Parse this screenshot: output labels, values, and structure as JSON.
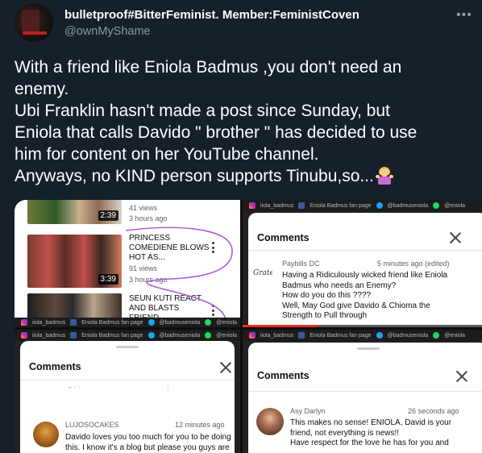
{
  "author": {
    "display_name": "bulletproof#BitterFeminist. Member:FeministCoven",
    "handle": "@ownMyShame",
    "avatar": "dark-red-profile-avatar"
  },
  "more_icon": "more-horizontal-icon",
  "tweet_lines": [
    "With a friend like Eniola Badmus ,you don't need an",
    "enemy.",
    "Ubi Franklin hasn't made a post since Sunday, but",
    "Eniola that calls Davido \" brother \"  has decided to use",
    "him for content on her YouTube channel.",
    "Anyways,  no KIND person supports Tinubu,so..."
  ],
  "tweet_emoji": "woman-shrugging-icon",
  "colors": {
    "background": "#15202b",
    "secondary_text": "#8b98a5",
    "youtube_red": "#e52d27",
    "annotation_purple": "#b05ad8"
  },
  "youtube_list": {
    "videos": [
      {
        "duration": "2:39",
        "title": "",
        "views": "41 views",
        "age": "3 hours ago"
      },
      {
        "duration": "3:39",
        "title": "PRINCESS COMEDIENE BLOWS HOT AS...",
        "views": "91 views",
        "age": "3 hours ago"
      },
      {
        "duration": "",
        "title": "SEUN KUTI REACT AND BLASTS FRIEND...",
        "views": "",
        "age": ""
      }
    ],
    "watermark": [
      "iiola_badmus",
      "Eniola Badmus fan page",
      "@badmuseniola",
      "@eniola"
    ]
  },
  "comment_sheets": [
    {
      "heading": "Comments",
      "watermark": [
        "iiola_badmus",
        "Eniola Badmus fan page",
        "@badmuseniola",
        "@eniola"
      ],
      "comments": [
        {
          "author": "Paybills DC",
          "time": "5 minutes ago (edited)",
          "avatar_text": "Grateful",
          "lines": [
            "Having a Ridiculously wicked  friend like Eniola",
            "Badmus who needs an Enemy?",
            "How do you do this ????",
            "Well, May God give Davido & Chioma the",
            "Strength to Pull through"
          ]
        }
      ],
      "progress": 0.3
    },
    {
      "heading": "Comments",
      "watermark": [
        "iiola_badmus",
        "Eniola Badmus fan page",
        "@badmuseniola",
        "@eniola"
      ],
      "comments": [
        {
          "author": "LUJOSOCAKES",
          "time": "12 minutes ago",
          "lines": [
            "Davido loves you too much for you to be doing",
            "this. I know it's a blog but please you guys are"
          ]
        }
      ]
    },
    {
      "heading": "Comments",
      "watermark": [
        "iiola_badmus",
        "Eniola Badmus fan page",
        "@badmuseniola",
        "@eniola"
      ],
      "comments": [
        {
          "author": "Asy Darlyn",
          "time": "26 seconds ago",
          "lines": [
            "This makes no sense! ENIOLA, David is your",
            "friend, not everything is news!!",
            "Have respect for the love he has for you and"
          ]
        }
      ]
    }
  ]
}
